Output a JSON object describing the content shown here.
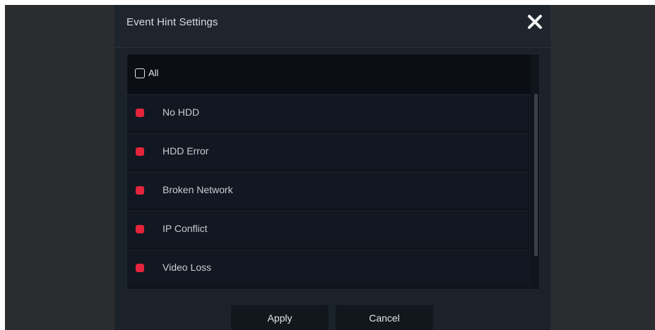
{
  "dialog": {
    "title": "Event Hint Settings",
    "close_icon": "close-icon"
  },
  "list": {
    "all_label": "All",
    "all_checked": false,
    "items": [
      {
        "label": "No HDD",
        "enabled": true
      },
      {
        "label": "HDD Error",
        "enabled": true
      },
      {
        "label": "Broken Network",
        "enabled": true
      },
      {
        "label": "IP Conflict",
        "enabled": true
      },
      {
        "label": "Video Loss",
        "enabled": true
      }
    ]
  },
  "buttons": {
    "apply_label": "Apply",
    "cancel_label": "Cancel"
  },
  "colors": {
    "enabled_dot": "#e3243b",
    "panel_bg": "#1b2229"
  }
}
